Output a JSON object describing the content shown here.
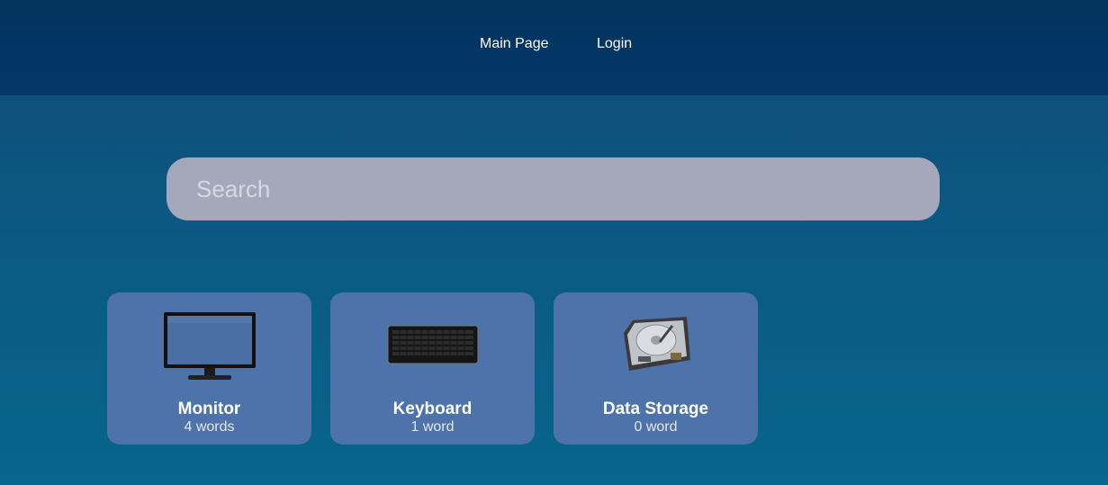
{
  "nav": {
    "main_page_label": "Main Page",
    "login_label": "Login"
  },
  "search": {
    "placeholder": "Search",
    "value": ""
  },
  "categories": [
    {
      "title": "Monitor",
      "count_label": "4 words",
      "icon": "monitor-image"
    },
    {
      "title": "Keyboard",
      "count_label": "1 word",
      "icon": "keyboard-image"
    },
    {
      "title": "Data Storage",
      "count_label": "0 word",
      "icon": "hard-drive-image"
    }
  ],
  "colors": {
    "header_bg": "#03355f",
    "page_bg": "#0b5a83",
    "search_bg": "#a3a9bb",
    "card_bg": "#4d73aa",
    "text": "#ffffff"
  }
}
